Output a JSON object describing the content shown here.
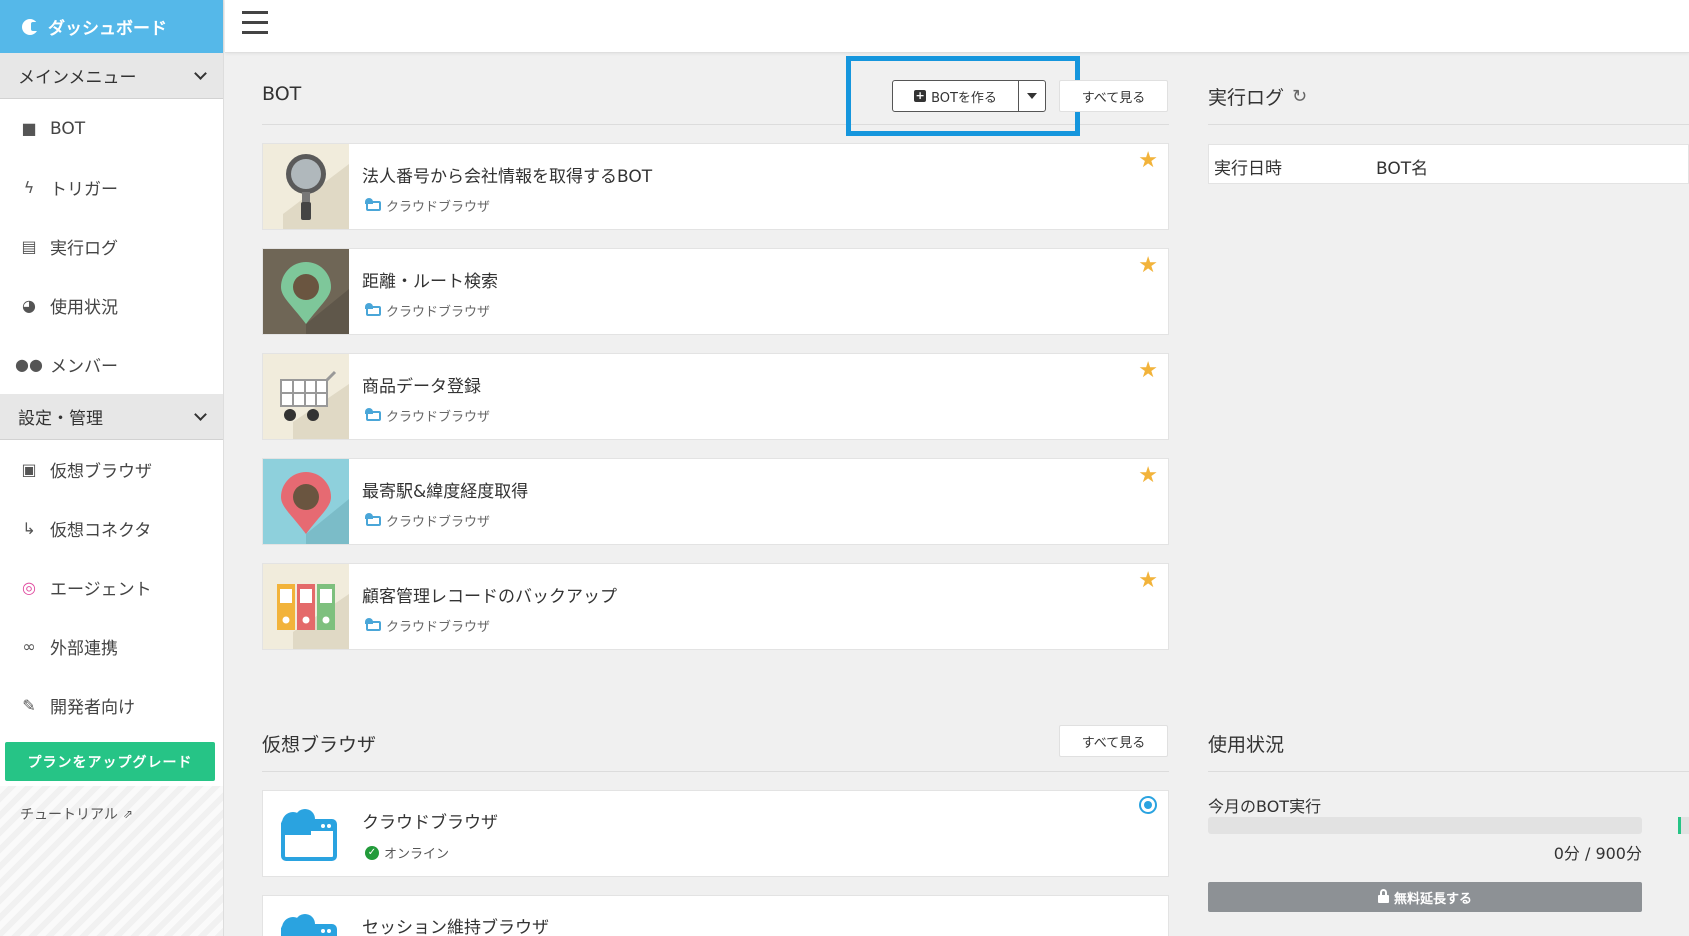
{
  "sidebar": {
    "brand": "ダッシュボード",
    "main_menu": "メインメニュー",
    "main_items": [
      {
        "label": "BOT",
        "icon": "robot-icon"
      },
      {
        "label": "トリガー",
        "icon": "lightning-icon"
      },
      {
        "label": "実行ログ",
        "icon": "document-icon"
      },
      {
        "label": "使用状況",
        "icon": "pie-chart-icon"
      },
      {
        "label": "メンバー",
        "icon": "users-icon"
      }
    ],
    "settings_menu": "設定・管理",
    "settings_items": [
      {
        "label": "仮想ブラウザ",
        "icon": "browser-icon"
      },
      {
        "label": "仮想コネクタ",
        "icon": "connector-icon"
      },
      {
        "label": "エージェント",
        "icon": "agent-icon"
      },
      {
        "label": "外部連携",
        "icon": "link-icon"
      },
      {
        "label": "開発者向け",
        "icon": "wrench-icon"
      }
    ],
    "upgrade_label": "プランをアップグレード",
    "tutorial_label": "チュートリアル"
  },
  "bot_panel": {
    "title": "BOT",
    "create_label": "BOTを作る",
    "see_all": "すべて見る",
    "bots": [
      {
        "name": "法人番号から会社情報を取得するBOT",
        "sub": "クラウドブラウザ",
        "thumb": "magnifier"
      },
      {
        "name": "距離・ルート検索",
        "sub": "クラウドブラウザ",
        "thumb": "map-pin-green"
      },
      {
        "name": "商品データ登録",
        "sub": "クラウドブラウザ",
        "thumb": "shopping-cart"
      },
      {
        "name": "最寄駅&緯度経度取得",
        "sub": "クラウドブラウザ",
        "thumb": "map-pin-red"
      },
      {
        "name": "顧客管理レコードのバックアップ",
        "sub": "クラウドブラウザ",
        "thumb": "binders"
      }
    ]
  },
  "log_panel": {
    "title": "実行ログ",
    "col_date": "実行日時",
    "col_bot": "BOT名"
  },
  "browser_panel": {
    "title": "仮想ブラウザ",
    "see_all": "すべて見る",
    "browsers": [
      {
        "name": "クラウドブラウザ",
        "status": "オンライン"
      },
      {
        "name": "セッション維持ブラウザ",
        "status": ""
      }
    ]
  },
  "usage_panel": {
    "title": "使用状況",
    "label": "今月のBOT実行",
    "value": "0分 / 900分",
    "fraction": 0.0,
    "extend_label": "無料延長する"
  },
  "colors": {
    "brand": "#55b8e9",
    "accent_green": "#26c486",
    "highlight": "#1596dd",
    "star": "#f2b33a"
  }
}
